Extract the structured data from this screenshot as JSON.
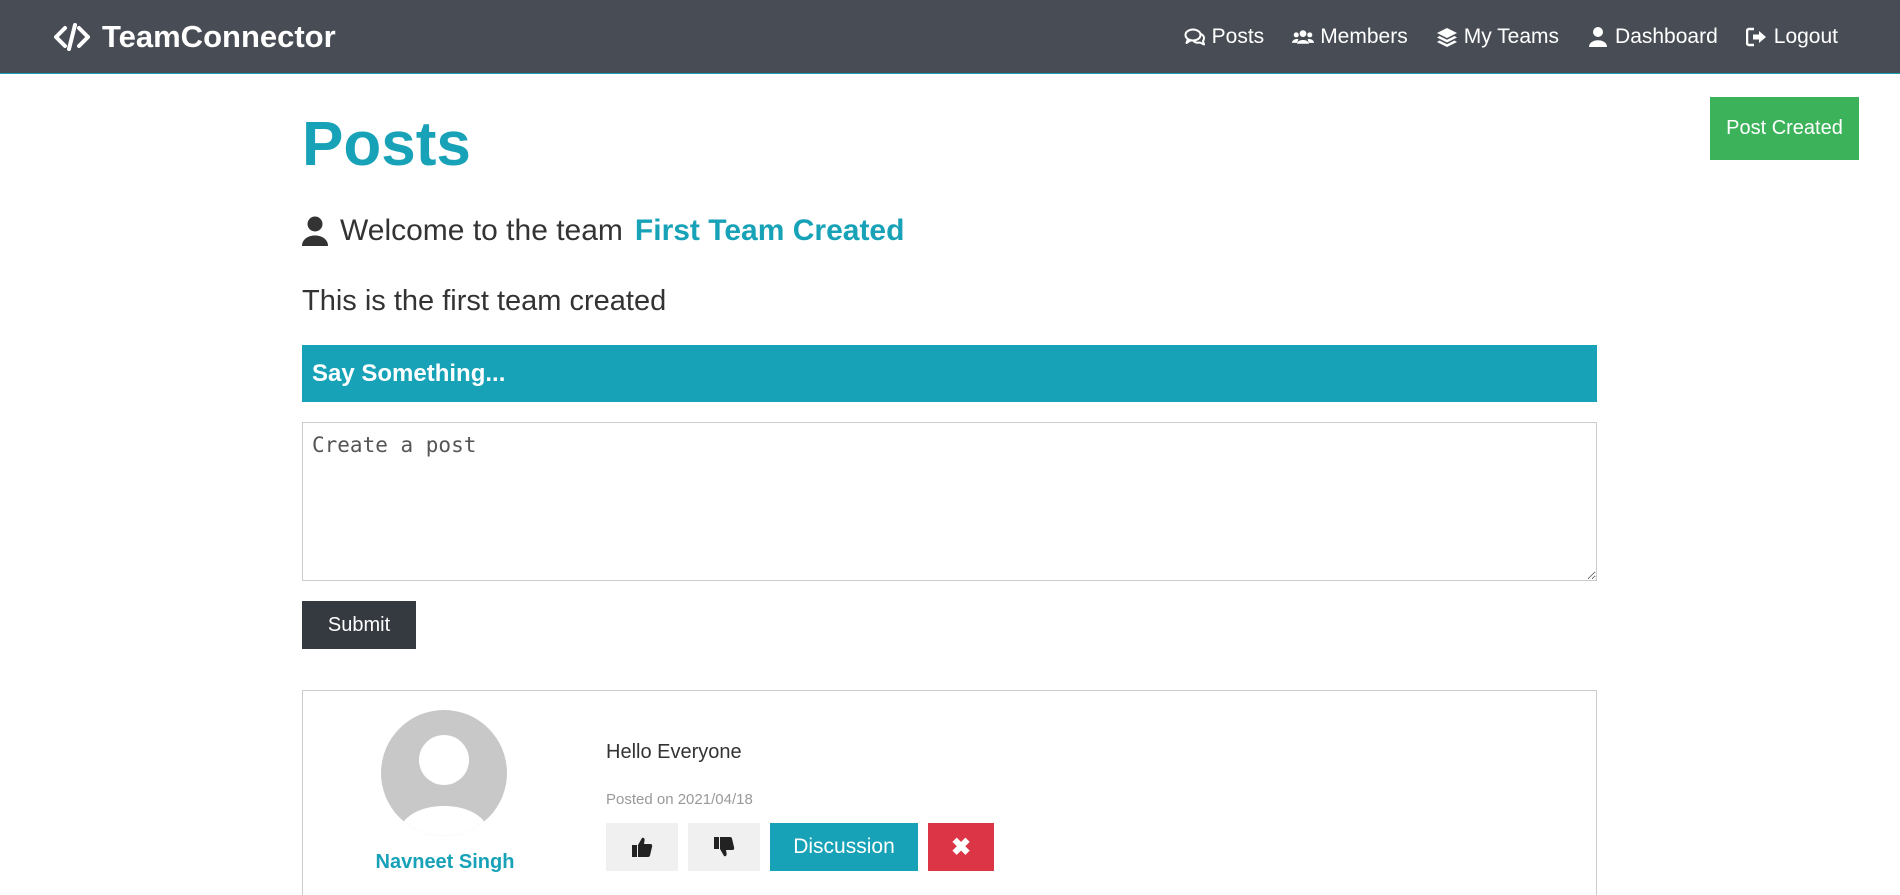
{
  "navbar": {
    "brand": "TeamConnector",
    "links": [
      {
        "label": "Posts",
        "icon": "comments-icon"
      },
      {
        "label": "Members",
        "icon": "users-icon"
      },
      {
        "label": "My Teams",
        "icon": "layers-icon"
      },
      {
        "label": "Dashboard",
        "icon": "user-icon"
      },
      {
        "label": "Logout",
        "icon": "sign-out-icon"
      }
    ]
  },
  "alert": {
    "text": "Post Created",
    "color": "#3cb35a"
  },
  "page": {
    "title": "Posts",
    "welcome_prefix": "Welcome to the team",
    "team_name": "First Team Created",
    "team_description": "This is the first team created"
  },
  "post_form": {
    "header": "Say Something...",
    "placeholder": "Create a post",
    "submit_label": "Submit"
  },
  "posts": [
    {
      "author": "Navneet Singh",
      "text": "Hello Everyone",
      "date": "Posted on 2021/04/18",
      "discussion_label": "Discussion",
      "delete_symbol": "✖"
    }
  ],
  "colors": {
    "navbar": "#484d55",
    "accent": "#17a2b8",
    "dark_button": "#343a40",
    "danger": "#dc3545",
    "success": "#3cb35a"
  }
}
